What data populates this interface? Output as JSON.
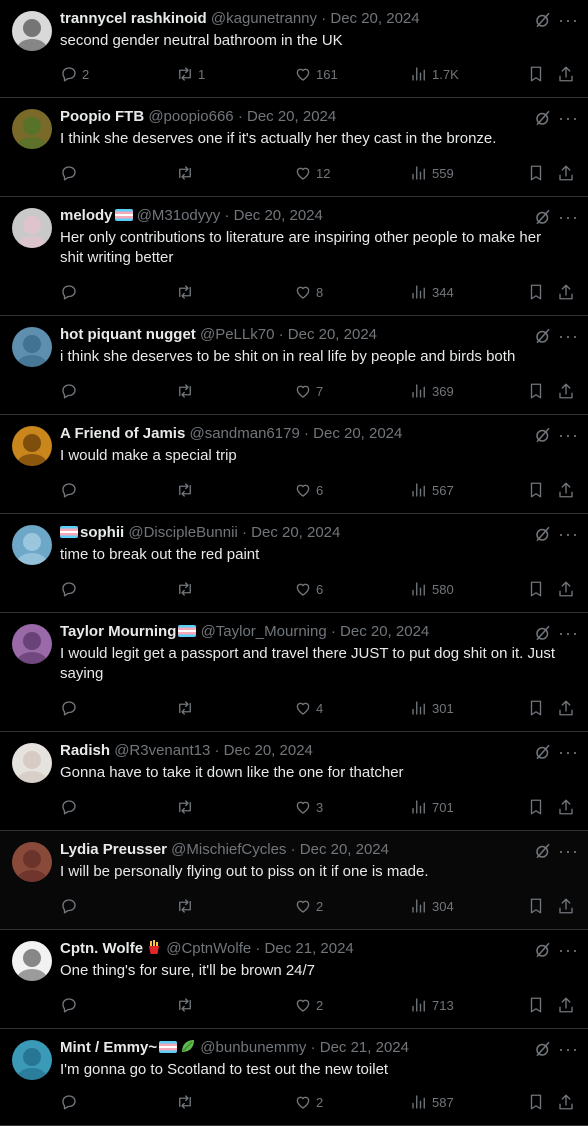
{
  "tweets": [
    {
      "name": "trannycel rashkinoid",
      "flag": false,
      "emoji": "",
      "handle": "@kagunetranny",
      "dot": "·",
      "date": "Dec 20, 2024",
      "text": [
        "second gender neutral bathroom in the UK"
      ],
      "replies": "2",
      "retweets": "1",
      "likes": "161",
      "views": "1.7K",
      "avatar_color": "#d9d9d9"
    },
    {
      "name": "Poopio FTB",
      "flag": false,
      "emoji": "",
      "handle": "@poopio666",
      "dot": "·",
      "date": "Dec 20, 2024",
      "text": [
        "I think she deserves one if it's actually her they cast in the bronze."
      ],
      "replies": "",
      "retweets": "",
      "likes": "12",
      "views": "559",
      "avatar_color": "#7a6a2a"
    },
    {
      "name": "melody",
      "flag": true,
      "emoji": "",
      "handle": "@M31odyyy",
      "dot": "·",
      "date": "Dec 20, 2024",
      "text": [
        "Her only contributions to literature are inspiring other people to make her",
        "shit writing better"
      ],
      "replies": "",
      "retweets": "",
      "likes": "8",
      "views": "344",
      "avatar_color": "#c9c9c9"
    },
    {
      "name": "hot piquant nugget",
      "flag": false,
      "emoji": "",
      "handle": "@PeLLk70",
      "dot": "·",
      "date": "Dec 20, 2024",
      "text": [
        "i think she deserves to be shit on in real life by people and birds both"
      ],
      "replies": "",
      "retweets": "",
      "likes": "7",
      "views": "369",
      "avatar_color": "#5f8fae"
    },
    {
      "name": "A Friend of Jamis",
      "flag": false,
      "emoji": "",
      "handle": "@sandman6179",
      "dot": "·",
      "date": "Dec 20, 2024",
      "text": [
        "I would make a special trip"
      ],
      "replies": "",
      "retweets": "",
      "likes": "6",
      "views": "567",
      "avatar_color": "#c8861c"
    },
    {
      "name": "sophii",
      "flag": true,
      "flag_first": true,
      "emoji": "",
      "handle": "@DiscipleBunnii",
      "dot": "·",
      "date": "Dec 20, 2024",
      "text": [
        "time to break out the red paint"
      ],
      "replies": "",
      "retweets": "",
      "likes": "6",
      "views": "580",
      "avatar_color": "#6ea8c8"
    },
    {
      "name": "Taylor Mourning",
      "flag": true,
      "emoji": "",
      "handle": "@Taylor_Mourning",
      "dot": "·",
      "date": "Dec 20, 2024",
      "text": [
        "I would legit get a passport and travel there JUST to put dog shit on it. Just",
        "saying"
      ],
      "replies": "",
      "retweets": "",
      "likes": "4",
      "views": "301",
      "avatar_color": "#9a6aa8"
    },
    {
      "name": "Radish",
      "flag": false,
      "emoji": "",
      "handle": "@R3venant13",
      "dot": "·",
      "date": "Dec 20, 2024",
      "text": [
        "Gonna have to take it down like the one for thatcher"
      ],
      "replies": "",
      "retweets": "",
      "likes": "3",
      "views": "701",
      "avatar_color": "#e6e2de"
    },
    {
      "name": "Lydia Preusser",
      "flag": false,
      "emoji": "",
      "handle": "@MischiefCycles",
      "dot": "·",
      "date": "Dec 20, 2024",
      "text": [
        "I will be personally flying out to piss on it if one is made."
      ],
      "replies": "",
      "retweets": "",
      "likes": "2",
      "views": "304",
      "avatar_color": "#8a4a3a",
      "highlight": true
    },
    {
      "name": "Cptn. Wolfe",
      "flag": false,
      "emoji": "fries",
      "handle": "@CptnWolfe",
      "dot": "·",
      "date": "Dec 21, 2024",
      "text": [
        "One thing's for sure, it'll be brown 24/7"
      ],
      "replies": "",
      "retweets": "",
      "likes": "2",
      "views": "713",
      "avatar_color": "#f2f2f2"
    },
    {
      "name": "Mint / Emmy~",
      "flag": true,
      "emoji": "leaf",
      "handle": "@bunbunemmy",
      "dot": "·",
      "date": "Dec 21, 2024",
      "text": [
        "I'm gonna go to Scotland to test out the new toilet"
      ],
      "replies": "",
      "retweets": "",
      "likes": "2",
      "views": "587",
      "avatar_color": "#3a9ab8"
    }
  ],
  "icons": {
    "reply": "reply-icon",
    "retweet": "retweet-icon",
    "like": "heart-icon",
    "views": "views-icon",
    "bookmark": "bookmark-icon",
    "share": "share-icon",
    "grok": "grok-icon",
    "more": "more-icon"
  },
  "more_glyph": "···"
}
